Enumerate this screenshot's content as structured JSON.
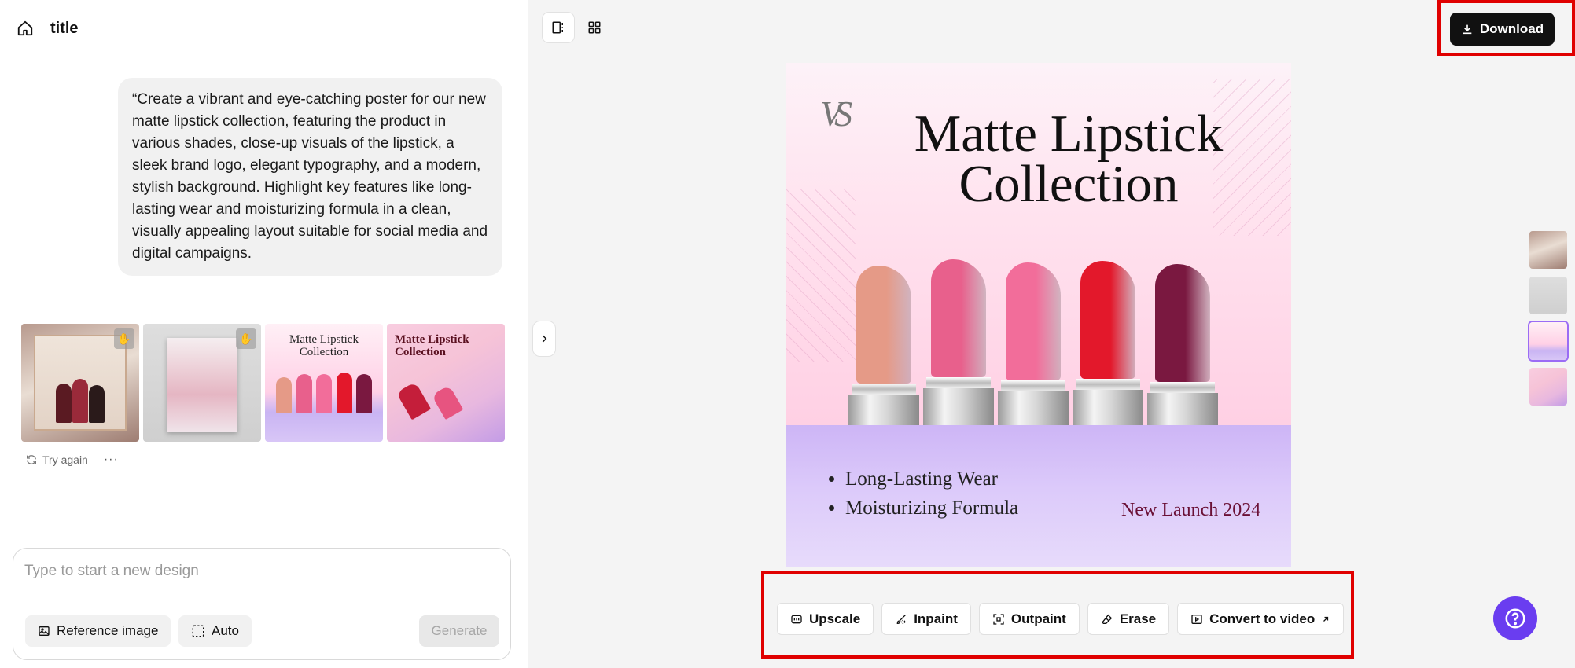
{
  "header": {
    "title": "title"
  },
  "prompt": {
    "text": "“Create a vibrant and eye-catching poster for our new matte lipstick collection, featuring the product in various shades, close-up visuals of the lipstick, a sleek brand logo, elegant typography, and a modern, stylish background. Highlight key features like long-lasting wear and moisturizing formula in a clean, visually appealing layout suitable for social media and digital campaigns."
  },
  "results": {
    "thumbs": [
      {
        "label": ""
      },
      {
        "label": ""
      },
      {
        "label": "Matte Lipstick Collection"
      },
      {
        "label": "Matte Lipstick Collection"
      }
    ],
    "try_again_label": "Try again",
    "more_label": "···"
  },
  "composer": {
    "placeholder": "Type to start a new design",
    "reference_label": "Reference image",
    "auto_label": "Auto",
    "generate_label": "Generate"
  },
  "toolbar": {
    "download_label": "Download"
  },
  "poster": {
    "monogram": "VS",
    "title_line1": "Matte Lipstick",
    "title_line2": "Collection",
    "features": [
      "Long-Lasting Wear",
      "Moisturizing Formula"
    ],
    "launch": "New Launch 2024",
    "shades": [
      "#e59a87",
      "#e8608c",
      "#f26d9a",
      "#e3182b",
      "#7a1840"
    ]
  },
  "tools": {
    "upscale": "Upscale",
    "inpaint": "Inpaint",
    "outpaint": "Outpaint",
    "erase": "Erase",
    "convert": "Convert to video"
  },
  "colors": {
    "accent": "#6a3df0",
    "highlight": "#e00000",
    "primary_button": "#111111"
  }
}
